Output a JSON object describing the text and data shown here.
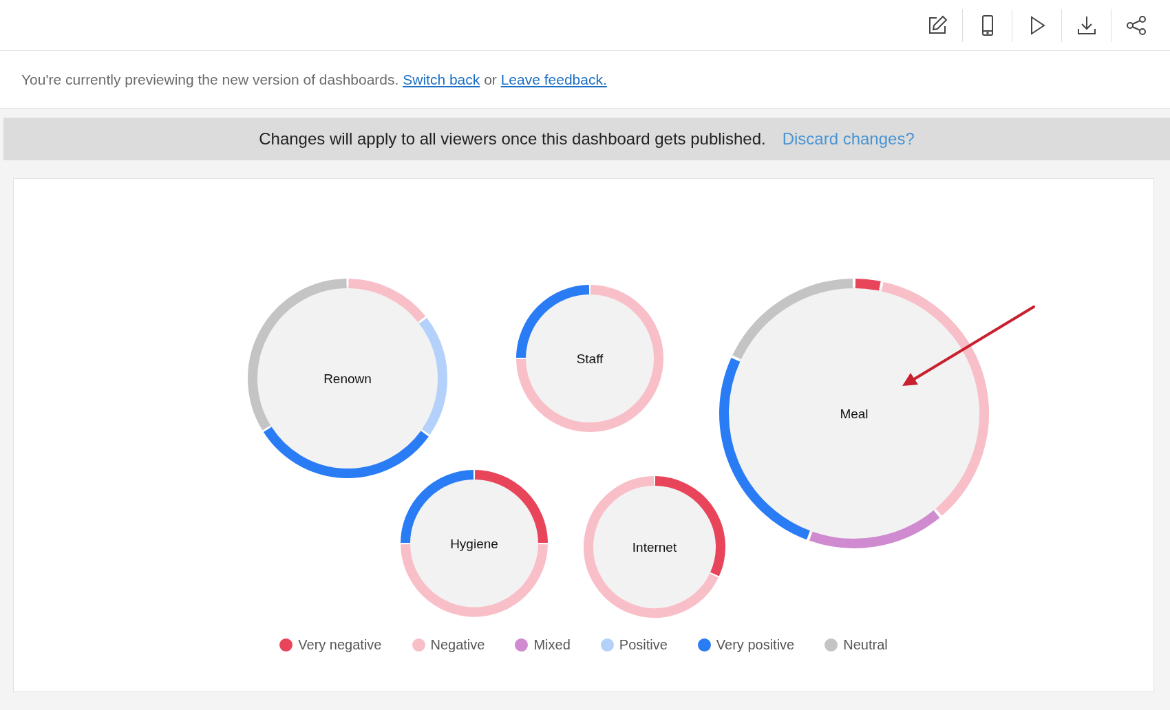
{
  "preview_notice": {
    "text": "You're currently previewing the new version of dashboards.",
    "switch_link": "Switch back",
    "connector": "or",
    "feedback_link": "Leave feedback."
  },
  "publish_bar": {
    "text": "Changes will apply to all viewers once this dashboard gets published.",
    "discard_link": "Discard changes?"
  },
  "bubbles": [
    {
      "label": "Renown"
    },
    {
      "label": "Staff"
    },
    {
      "label": "Meal"
    },
    {
      "label": "Hygiene"
    },
    {
      "label": "Internet"
    }
  ],
  "legend": [
    {
      "label": "Very negative",
      "color": "#e8445a"
    },
    {
      "label": "Negative",
      "color": "#f9bfc8"
    },
    {
      "label": "Mixed",
      "color": "#cf8ad0"
    },
    {
      "label": "Positive",
      "color": "#b3d1fb"
    },
    {
      "label": "Very positive",
      "color": "#2a7cf5"
    },
    {
      "label": "Neutral",
      "color": "#c4c4c4"
    }
  ]
}
